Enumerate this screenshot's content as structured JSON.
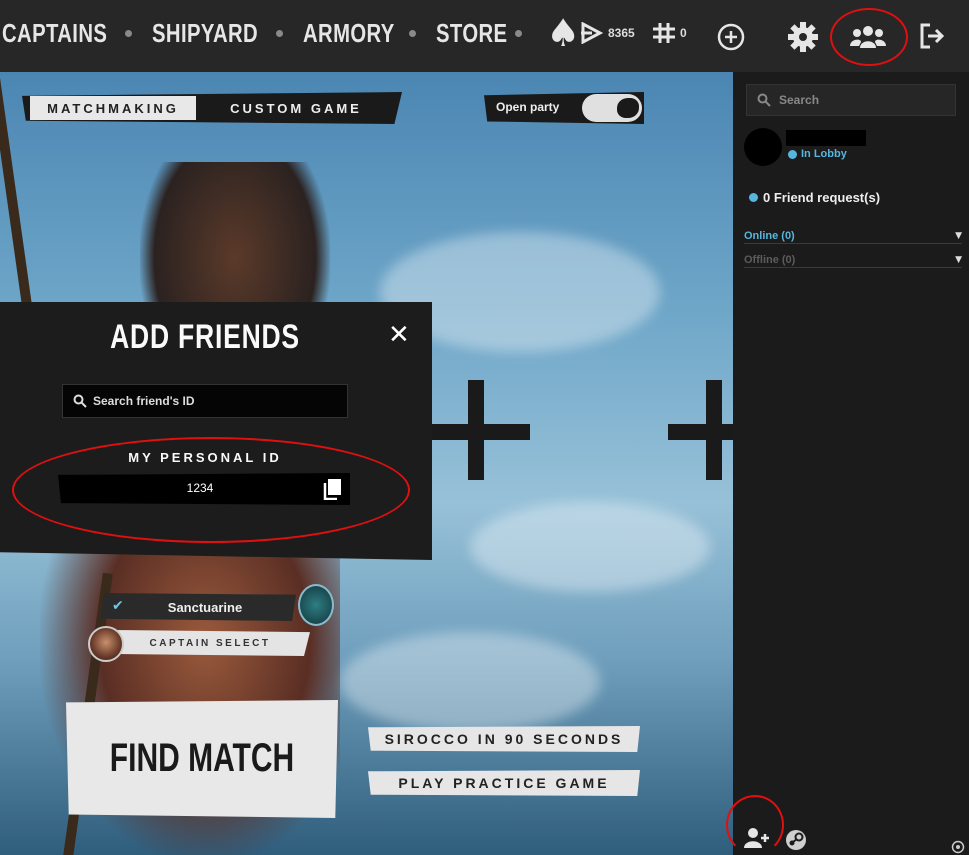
{
  "nav": {
    "items": [
      "CAPTAINS",
      "SHIPYARD",
      "ARMORY",
      "STORE"
    ],
    "icons": [
      "spade-icon"
    ]
  },
  "currency": {
    "primary_value": "8365",
    "secondary_value": "0"
  },
  "mode_tabs": {
    "matchmaking": "MATCHMAKING",
    "custom_game": "CUSTOM GAME"
  },
  "party": {
    "label": "Open party",
    "enabled": true
  },
  "add_friends": {
    "title": "ADD FRIENDS",
    "search_placeholder": "Search friend's ID",
    "my_id_label": "MY PERSONAL ID",
    "my_id_value": "1234"
  },
  "captain": {
    "name": "Sanctuarine",
    "select_label": "CAPTAIN SELECT"
  },
  "actions": {
    "find_match": "FIND MATCH",
    "sirocco_tutorial": "SIROCCO IN 90 SECONDS",
    "practice": "PLAY PRACTICE GAME"
  },
  "friends_panel": {
    "search_placeholder": "Search",
    "user_status": "In Lobby",
    "friend_requests": "0 Friend request(s)",
    "online_group": "Online (0)",
    "offline_group": "Offline (0)"
  },
  "colors": {
    "accent": "#56b6de",
    "highlight_circle": "#e01010",
    "panel_bg": "#1b1b1b"
  }
}
